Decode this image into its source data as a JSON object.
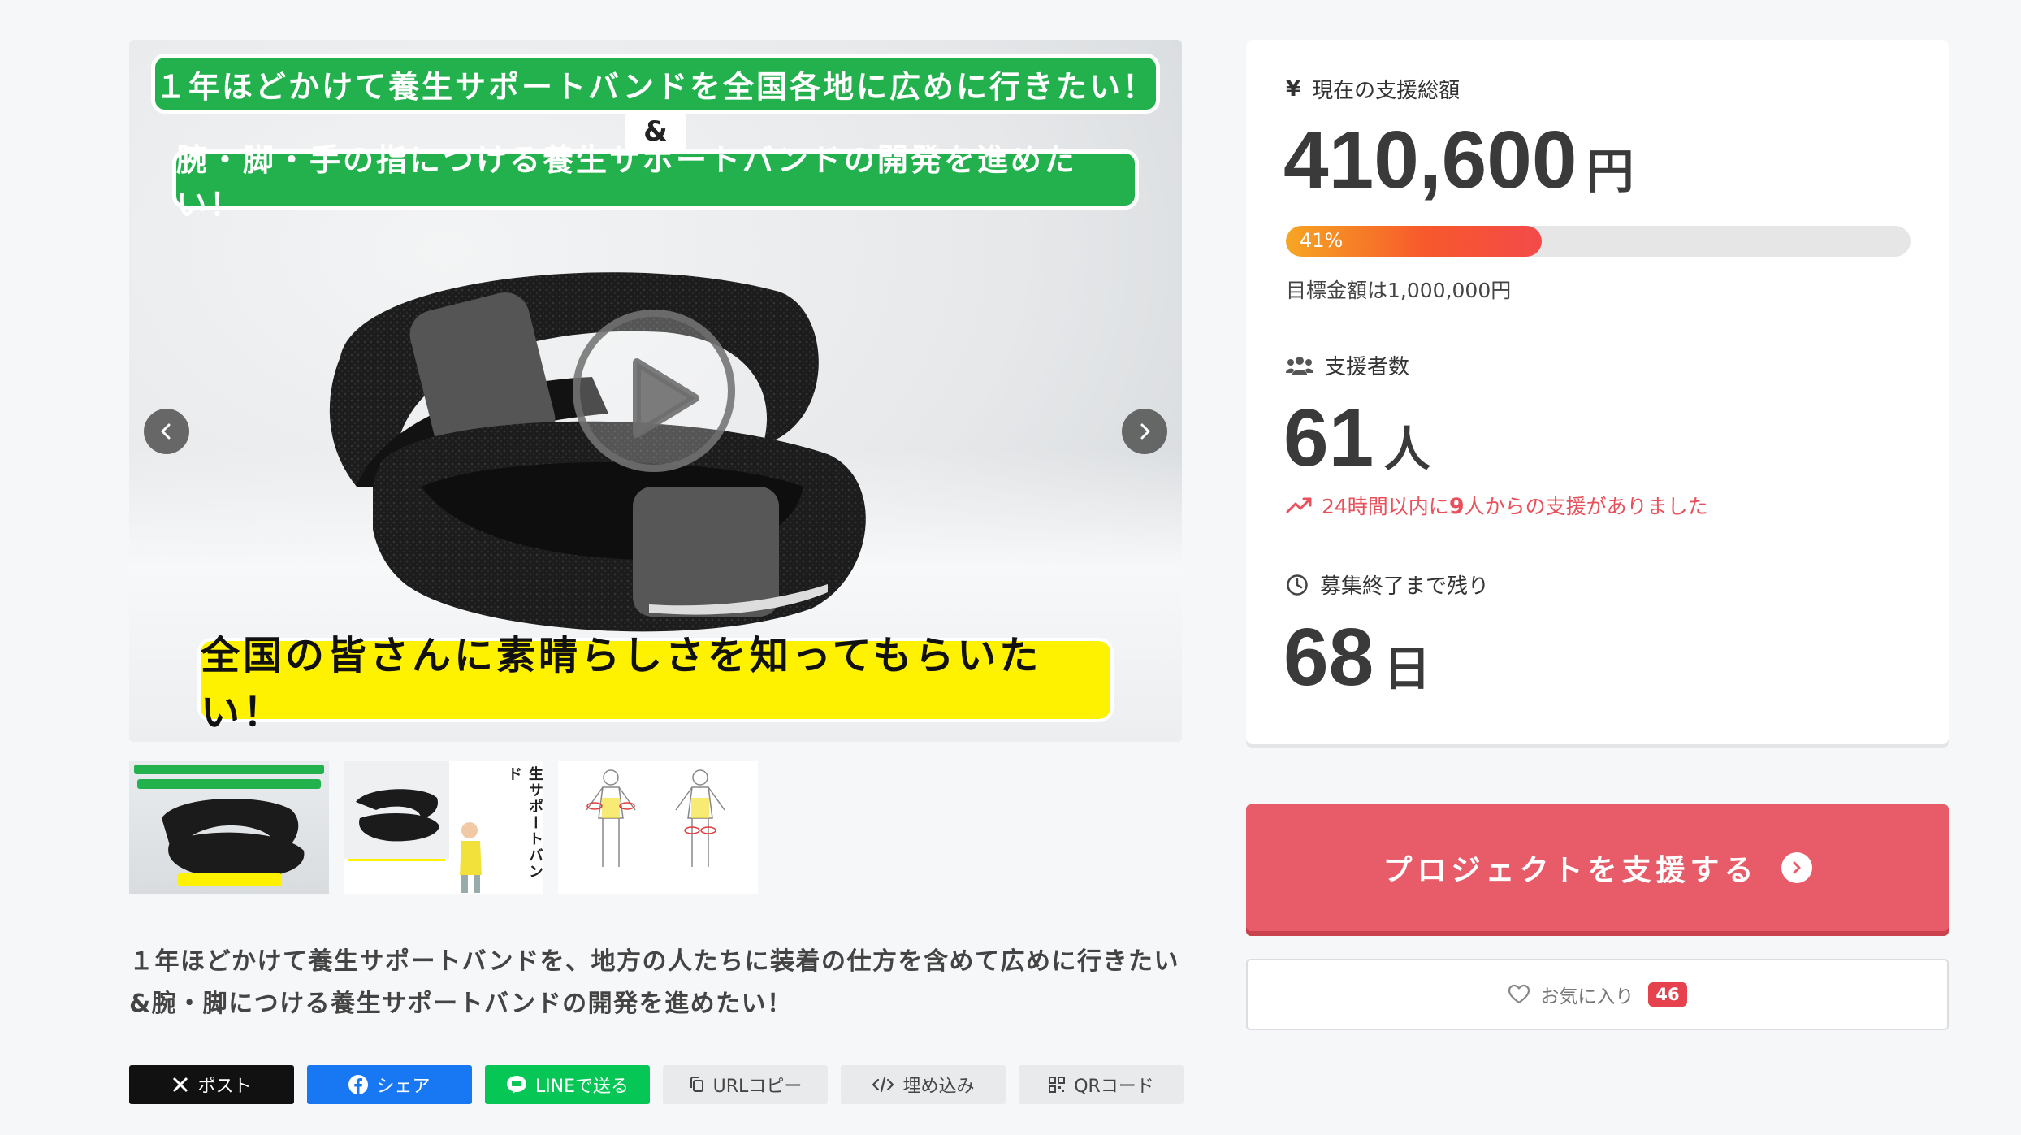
{
  "hero": {
    "banner_top_line1": "１年ほどかけて養生サポートバンドを全国各地に広めに行きたい！",
    "banner_amp": "&",
    "banner_top_line2": "腕・脚・手の指につける養生サポートバンドの開発を進めたい！",
    "banner_bottom": "全国の皆さんに素晴らしさを知ってもらいたい！"
  },
  "thumbnails": {
    "thumb2_text": "生サポートバンド"
  },
  "description": "１年ほどかけて養生サポートバンドを、地方の人たちに装着の仕方を含めて広めに行きたい&腕・脚につける養生サポートバンドの開発を進めたい！",
  "share": {
    "x_label": "ポスト",
    "facebook_label": "シェア",
    "line_label": "LINEで送る",
    "url_label": "URLコピー",
    "embed_label": "埋め込み",
    "qr_label": "QRコード"
  },
  "stats": {
    "total_label": "現在の支援総額",
    "yen_symbol": "¥",
    "total_amount": "410,600",
    "total_unit": "円",
    "progress_percent": 41,
    "progress_text": "41%",
    "goal_text": "目標金額は1,000,000円",
    "supporters_label": "支援者数",
    "supporters_count": "61",
    "supporters_unit": "人",
    "recent_prefix": "24時間以内に",
    "recent_count": "9",
    "recent_suffix": "人からの支援がありました",
    "remaining_label": "募集終了まで残り",
    "remaining_days": "68",
    "remaining_unit": "日"
  },
  "actions": {
    "support_label": "プロジェクトを支援する",
    "favorite_label": "お気に入り",
    "favorite_count": "46"
  },
  "colors": {
    "accent_red": "#e75c68",
    "progress_start": "#f6a623",
    "progress_end": "#f34a4a",
    "badge_red": "#e5424d",
    "green_banner": "#23b14d",
    "yellow_banner": "#fff200"
  }
}
